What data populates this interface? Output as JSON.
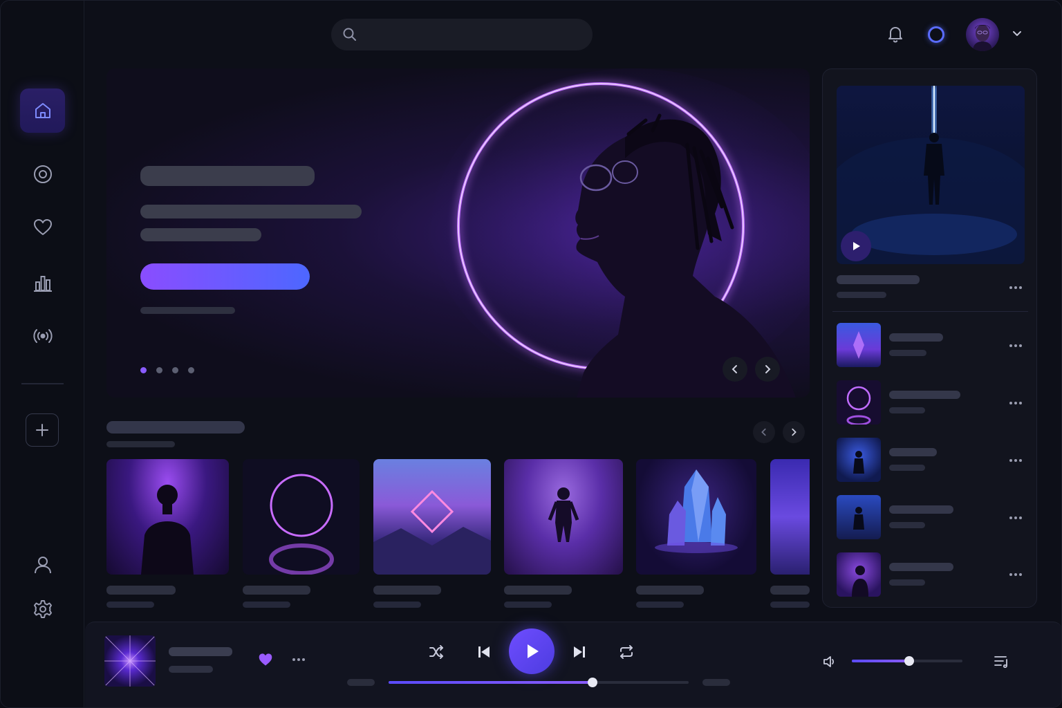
{
  "app": {
    "accent": "#7b5cff",
    "brand_gradient": [
      "#8a4dff",
      "#4d67ff"
    ]
  },
  "sidebar": {
    "logo": "waveform-logo",
    "items": [
      {
        "name": "home",
        "icon": "home-icon",
        "active": true
      },
      {
        "name": "discover",
        "icon": "disc-icon"
      },
      {
        "name": "favorites",
        "icon": "heart-icon"
      },
      {
        "name": "charts",
        "icon": "bar-chart-icon"
      },
      {
        "name": "radio",
        "icon": "broadcast-icon"
      }
    ],
    "add": "plus-icon",
    "bottom": [
      "user-icon",
      "gear-icon"
    ]
  },
  "topbar": {
    "search_placeholder": "",
    "icons": [
      "bell-icon",
      "status-ring",
      "avatar",
      "chevron-down-icon"
    ]
  },
  "hero": {
    "slides": 4,
    "active_slide": 1
  },
  "player": {
    "progress": 0.68,
    "volume": 0.52,
    "liked": true
  }
}
